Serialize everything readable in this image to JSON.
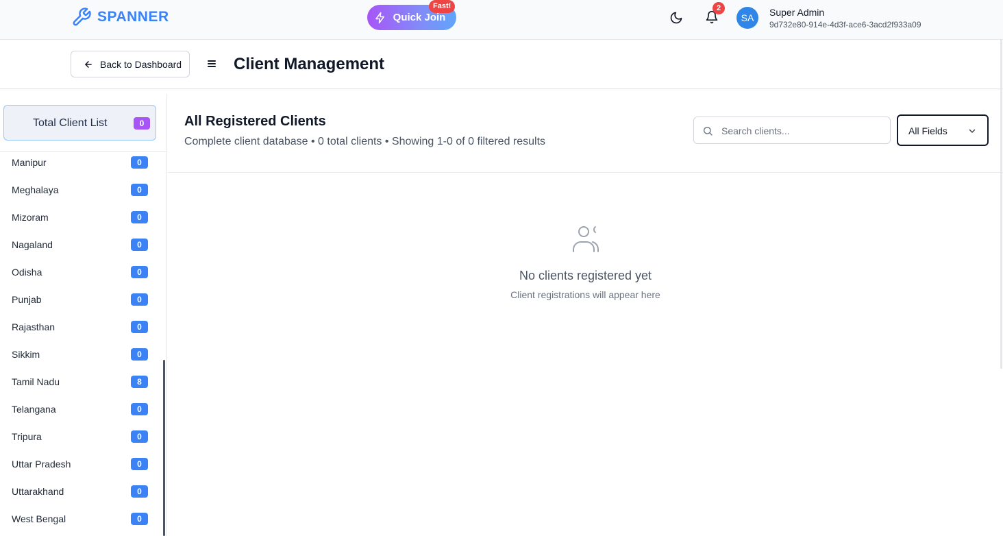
{
  "brand": {
    "name": "SPANNER",
    "color": "#3b82f6"
  },
  "topbar": {
    "quick_join_label": "Quick Join",
    "fast_badge": "Fast!",
    "notification_count": "2",
    "avatar_initials": "SA",
    "user_name": "Super Admin",
    "user_id": "9d732e80-914e-4d3f-ace6-3acd2f933a09"
  },
  "header": {
    "back_label": "Back to Dashboard",
    "title": "Client Management"
  },
  "sidebar": {
    "total_label": "Total Client List",
    "total_count": "0",
    "states": [
      {
        "name": "Manipur",
        "count": "0"
      },
      {
        "name": "Meghalaya",
        "count": "0"
      },
      {
        "name": "Mizoram",
        "count": "0"
      },
      {
        "name": "Nagaland",
        "count": "0"
      },
      {
        "name": "Odisha",
        "count": "0"
      },
      {
        "name": "Punjab",
        "count": "0"
      },
      {
        "name": "Rajasthan",
        "count": "0"
      },
      {
        "name": "Sikkim",
        "count": "0"
      },
      {
        "name": "Tamil Nadu",
        "count": "8"
      },
      {
        "name": "Telangana",
        "count": "0"
      },
      {
        "name": "Tripura",
        "count": "0"
      },
      {
        "name": "Uttar Pradesh",
        "count": "0"
      },
      {
        "name": "Uttarakhand",
        "count": "0"
      },
      {
        "name": "West Bengal",
        "count": "0"
      }
    ]
  },
  "main": {
    "title": "All Registered Clients",
    "subtitle": "Complete client database • 0 total clients • Showing 1-0 of 0 filtered results",
    "search": {
      "placeholder": "Search clients...",
      "value": ""
    },
    "field_filter": "All Fields",
    "empty": {
      "title": "No clients registered yet",
      "subtitle": "Client registrations will appear here"
    }
  },
  "colors": {
    "accent": "#3b82f6",
    "purple_badge": "#a855f7",
    "danger": "#ef4444"
  }
}
